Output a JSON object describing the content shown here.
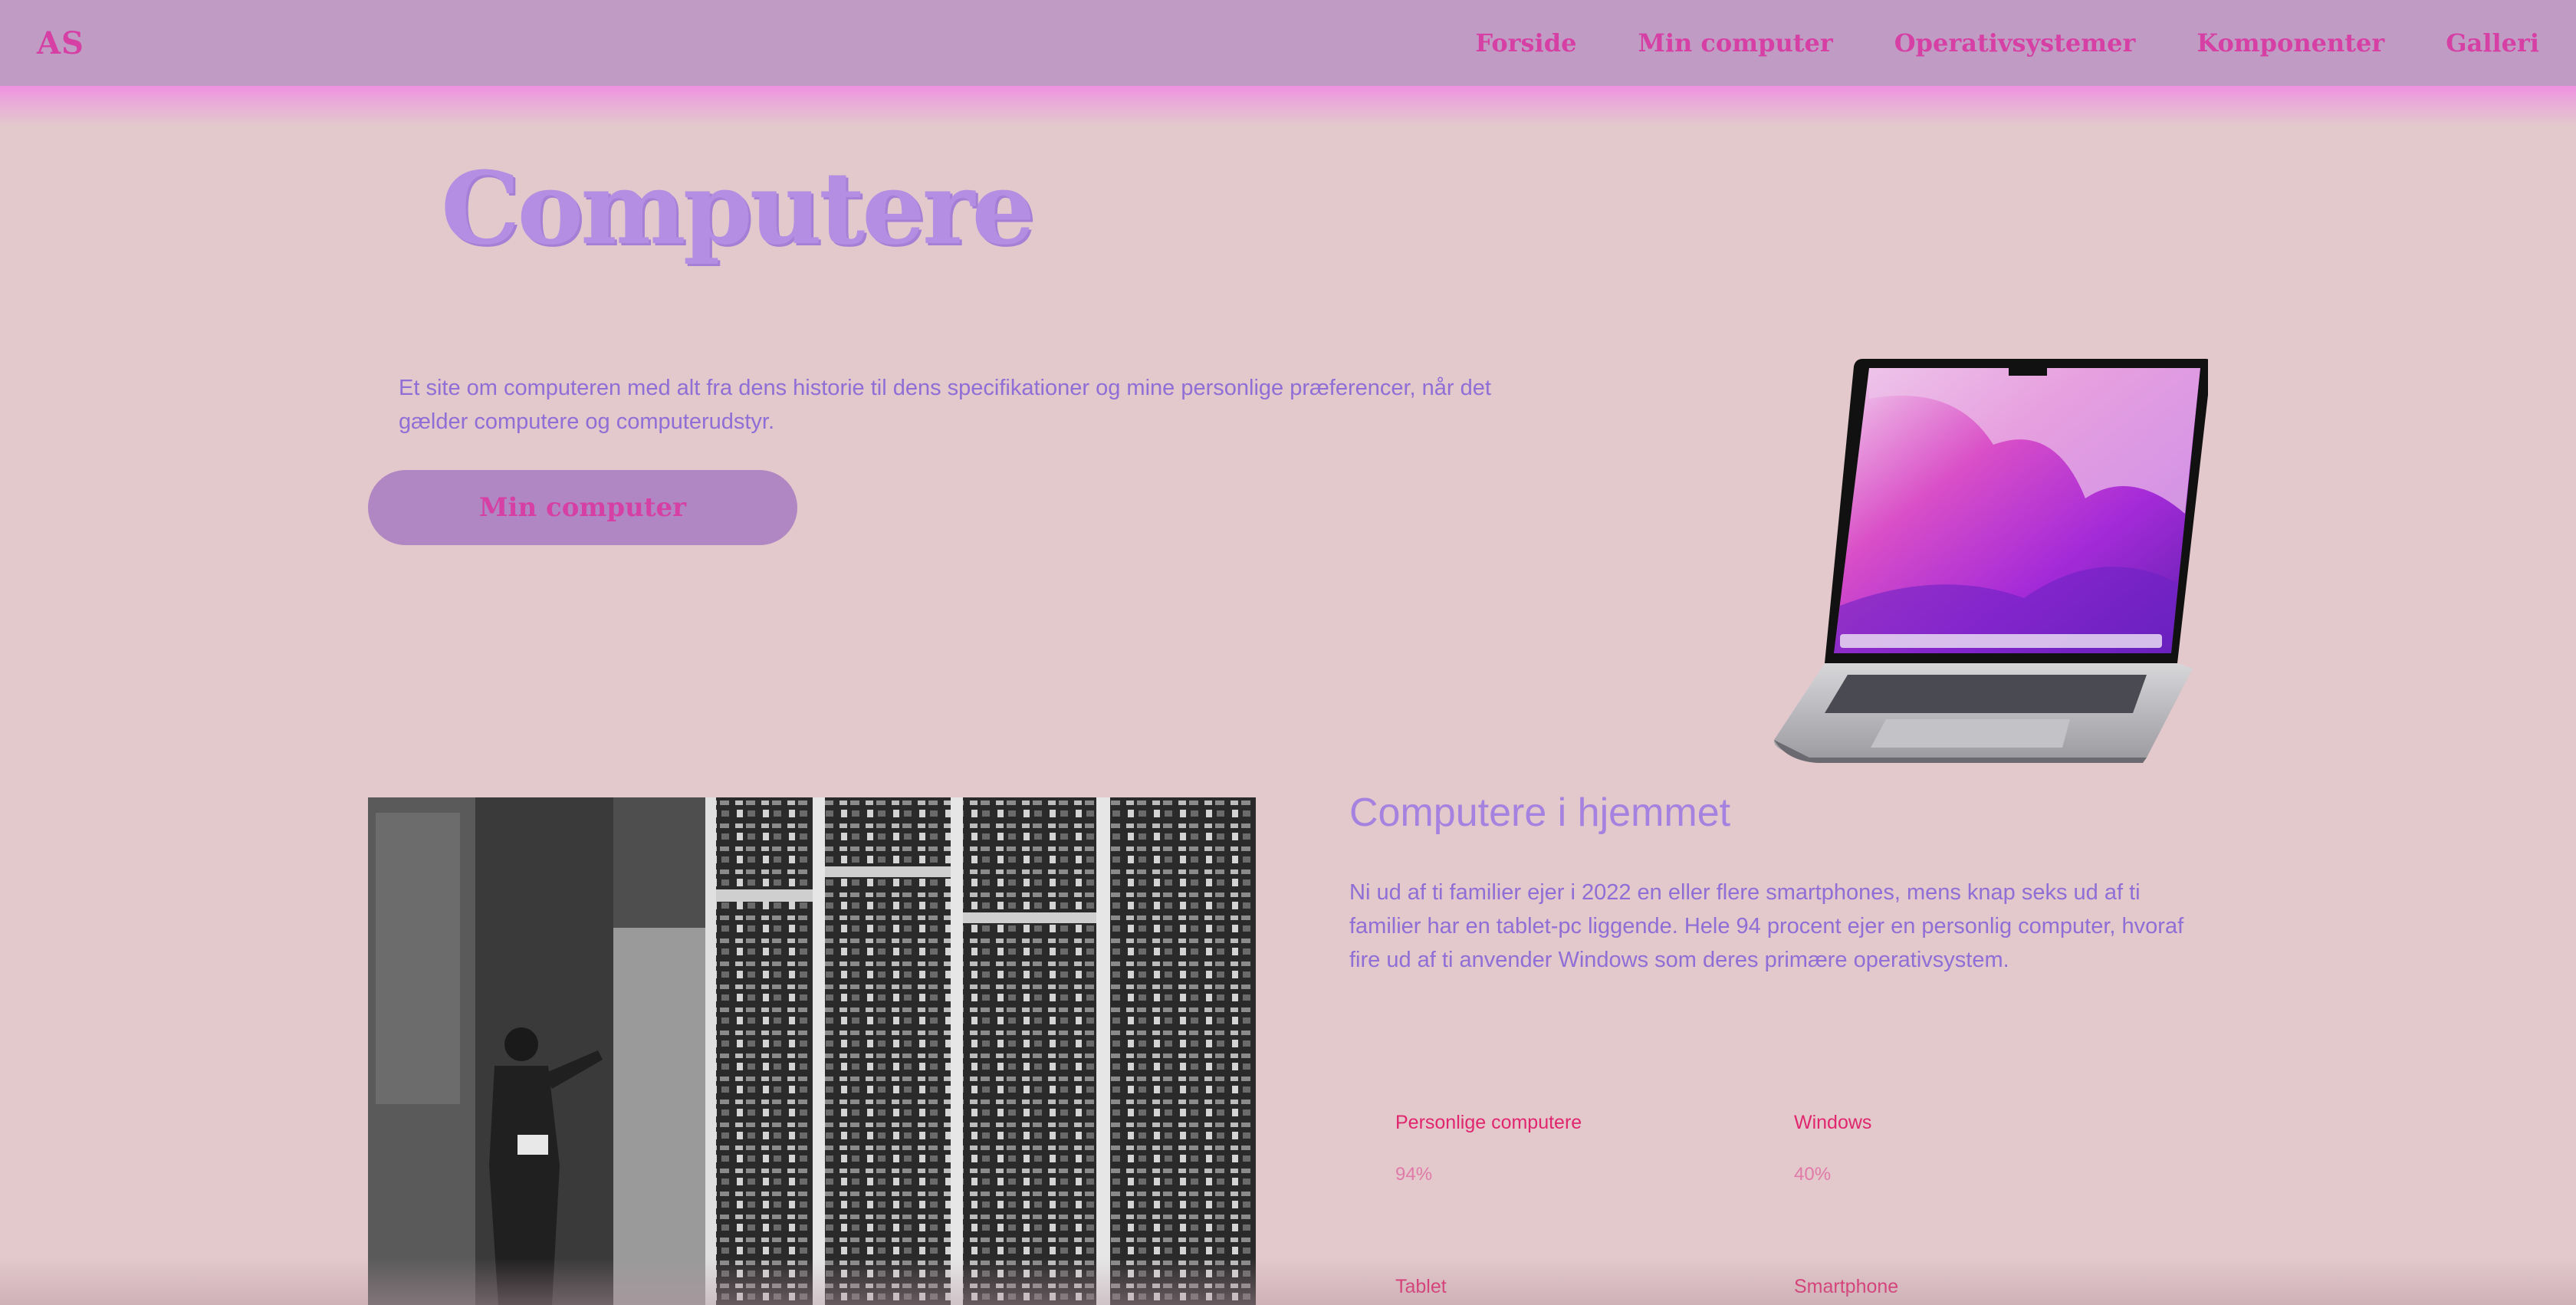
{
  "nav": {
    "logo": "AS",
    "links": [
      "Forside",
      "Min computer",
      "Operativsystemer",
      "Komponenter",
      "Galleri"
    ]
  },
  "hero": {
    "title": "Computere",
    "description": "Et site om computeren med alt fra dens historie til dens specifikationer og mine personlige præferencer, når det gælder computere og computerudstyr.",
    "button_label": "Min computer"
  },
  "home_section": {
    "title": "Computere i hjemmet",
    "text": "Ni ud af ti familier ejer i 2022 en eller flere smartphones, mens knap seks ud af ti familier har en tablet-pc liggende. Hele 94 procent ejer en personlig computer, hvoraf fire ud af ti anvender Windows som deres primære operativsystem.",
    "stats": [
      {
        "label": "Personlige computere",
        "value": "94%"
      },
      {
        "label": "Windows",
        "value": "40%"
      },
      {
        "label": "Tablet",
        "value": ""
      },
      {
        "label": "Smartphone",
        "value": ""
      }
    ]
  },
  "colors": {
    "background": "#e3c8cc",
    "navbar": "#c09cc5",
    "accent_pink": "#d63fa4",
    "accent_purple": "#b38ee2",
    "text_purple": "#8f6ed6",
    "stat_red": "#e0266e"
  },
  "images": {
    "hero_image": "laptop-illustration",
    "section_image": "historic-mainframe-photo"
  }
}
